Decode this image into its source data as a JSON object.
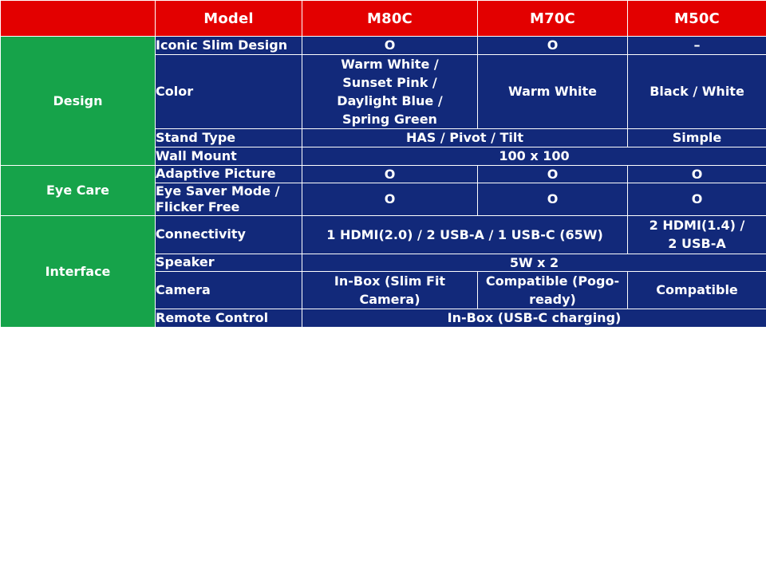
{
  "table": {
    "header": {
      "group_label": "",
      "feature_label": "Model",
      "columns": [
        "M80C",
        "M70C",
        "M50C"
      ]
    },
    "colors": {
      "header_bg": "#e30000",
      "group_bg": "#16a34a",
      "cell_bg": "#12297a",
      "text": "#ffffff"
    },
    "groups": [
      {
        "name": "Design",
        "rows": [
          {
            "feature": "Iconic Slim Design",
            "cells": [
              {
                "text": "O"
              },
              {
                "text": "O"
              },
              {
                "text": "–"
              }
            ]
          },
          {
            "feature": "Color",
            "cells": [
              {
                "text": "Warm White /\nSunset Pink /\nDaylight Blue /\nSpring Green"
              },
              {
                "text": "Warm White"
              },
              {
                "text": "Black / White"
              }
            ]
          },
          {
            "feature": "Stand Type",
            "cells": [
              {
                "text": "HAS / Pivot / Tilt",
                "span": 2
              },
              {
                "text": "Simple"
              }
            ]
          },
          {
            "feature": "Wall Mount",
            "cells": [
              {
                "text": "100 x 100",
                "span": 3
              }
            ]
          }
        ]
      },
      {
        "name": "Eye Care",
        "rows": [
          {
            "feature": "Adaptive Picture",
            "cells": [
              {
                "text": "O"
              },
              {
                "text": "O"
              },
              {
                "text": "O"
              }
            ]
          },
          {
            "feature": "Eye Saver Mode /\nFlicker Free",
            "cells": [
              {
                "text": "O"
              },
              {
                "text": "O"
              },
              {
                "text": "O"
              }
            ]
          }
        ]
      },
      {
        "name": "Interface",
        "rows": [
          {
            "feature": "Connectivity",
            "cells": [
              {
                "text": "1 HDMI(2.0) / 2 USB-A / 1 USB-C (65W)",
                "span": 2
              },
              {
                "text": "2 HDMI(1.4) /\n2 USB-A"
              }
            ]
          },
          {
            "feature": "Speaker",
            "cells": [
              {
                "text": "5W x 2",
                "span": 3
              }
            ]
          },
          {
            "feature": "Camera",
            "cells": [
              {
                "text": "In-Box (Slim Fit\nCamera)"
              },
              {
                "text": "Compatible (Pogo-\nready)"
              },
              {
                "text": "Compatible"
              }
            ]
          },
          {
            "feature": "Remote Control",
            "cells": [
              {
                "text": "In-Box (USB-C charging)",
                "span": 3
              }
            ]
          }
        ]
      }
    ]
  }
}
